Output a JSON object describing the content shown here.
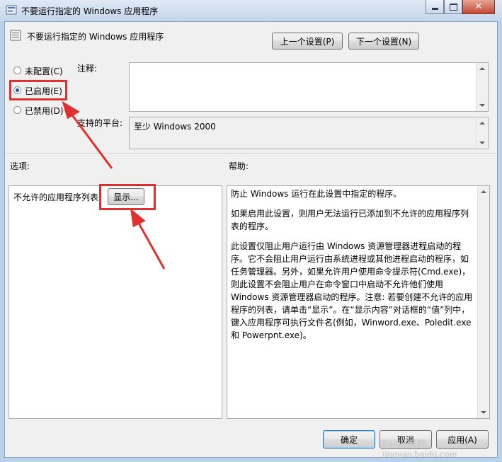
{
  "window": {
    "title": "不要运行指定的 Windows 应用程序",
    "icon": "policy-icon"
  },
  "header": {
    "policy_title": "不要运行指定的 Windows 应用程序",
    "prev_button": "上一个设置(P)",
    "next_button": "下一个设置(N)"
  },
  "radios": [
    {
      "label": "未配置(C)",
      "checked": false
    },
    {
      "label": "已启用(E)",
      "checked": true
    },
    {
      "label": "已禁用(D)",
      "checked": false
    }
  ],
  "comment": {
    "label": "注释:",
    "value": ""
  },
  "supported": {
    "label": "支持的平台:",
    "value": "至少 Windows 2000"
  },
  "options": {
    "label": "选项:",
    "list_label": "不允许的应用程序列表",
    "show_button": "显示..."
  },
  "help": {
    "label": "帮助:",
    "paragraphs": [
      "防止 Windows 运行在此设置中指定的程序。",
      "如果启用此设置，则用户无法运行已添加到不允许的应用程序列表的程序。",
      "此设置仅阻止用户运行由 Windows 资源管理器进程启动的程序。它不会阻止用户运行由系统进程或其他进程启动的程序，如任务管理器。另外，如果允许用户使用命令提示符(Cmd.exe)，则此设置不会阻止用户在命令窗口中启动不允许他们使用 Windows 资源管理器启动的程序。注意: 若要创建不允许的应用程序的列表，请单击“显示”。在“显示内容”对话框的“值”列中，键入应用程序可执行文件名(例如，Winword.exe、Poledit.exe 和 Powerpnt.exe)。"
    ]
  },
  "footer": {
    "ok_button": "确定",
    "cancel_button": "取消",
    "apply_button": "应用(A)"
  },
  "watermark": "Baidu 经验 jingyan.baidu.com",
  "colors": {
    "highlight": "#e03030",
    "window_frame": "#b9d1ea",
    "dialog_bg": "#f0f0f0"
  }
}
